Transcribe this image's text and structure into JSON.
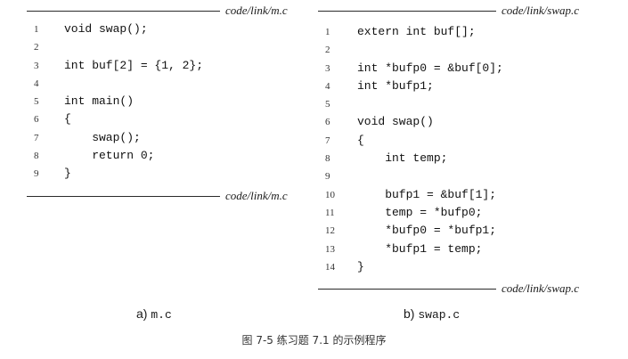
{
  "left_panel": {
    "filename_top": "code/link/m.c",
    "filename_bottom": "code/link/m.c",
    "lines": [
      {
        "n": "1",
        "text": "void swap();"
      },
      {
        "n": "2",
        "text": ""
      },
      {
        "n": "3",
        "text": "int buf[2] = {1, 2};"
      },
      {
        "n": "4",
        "text": ""
      },
      {
        "n": "5",
        "text": "int main()"
      },
      {
        "n": "6",
        "text": "{"
      },
      {
        "n": "7",
        "text": "    swap();"
      },
      {
        "n": "8",
        "text": "    return 0;"
      },
      {
        "n": "9",
        "text": "}"
      }
    ],
    "subcaption_prefix": "a)",
    "subcaption_file": "m.c"
  },
  "right_panel": {
    "filename_top": "code/link/swap.c",
    "filename_bottom": "code/link/swap.c",
    "lines": [
      {
        "n": "1",
        "text": "extern int buf[];"
      },
      {
        "n": "2",
        "text": ""
      },
      {
        "n": "3",
        "text": "int *bufp0 = &buf[0];"
      },
      {
        "n": "4",
        "text": "int *bufp1;"
      },
      {
        "n": "5",
        "text": ""
      },
      {
        "n": "6",
        "text": "void swap()"
      },
      {
        "n": "7",
        "text": "{"
      },
      {
        "n": "8",
        "text": "    int temp;"
      },
      {
        "n": "9",
        "text": ""
      },
      {
        "n": "10",
        "text": "    bufp1 = &buf[1];"
      },
      {
        "n": "11",
        "text": "    temp = *bufp0;"
      },
      {
        "n": "12",
        "text": "    *bufp0 = *bufp1;"
      },
      {
        "n": "13",
        "text": "    *bufp1 = temp;"
      },
      {
        "n": "14",
        "text": "}"
      }
    ],
    "subcaption_prefix": "b)",
    "subcaption_file": "swap.c"
  },
  "figure_caption": "图 7-5   练习题 7.1 的示例程序"
}
